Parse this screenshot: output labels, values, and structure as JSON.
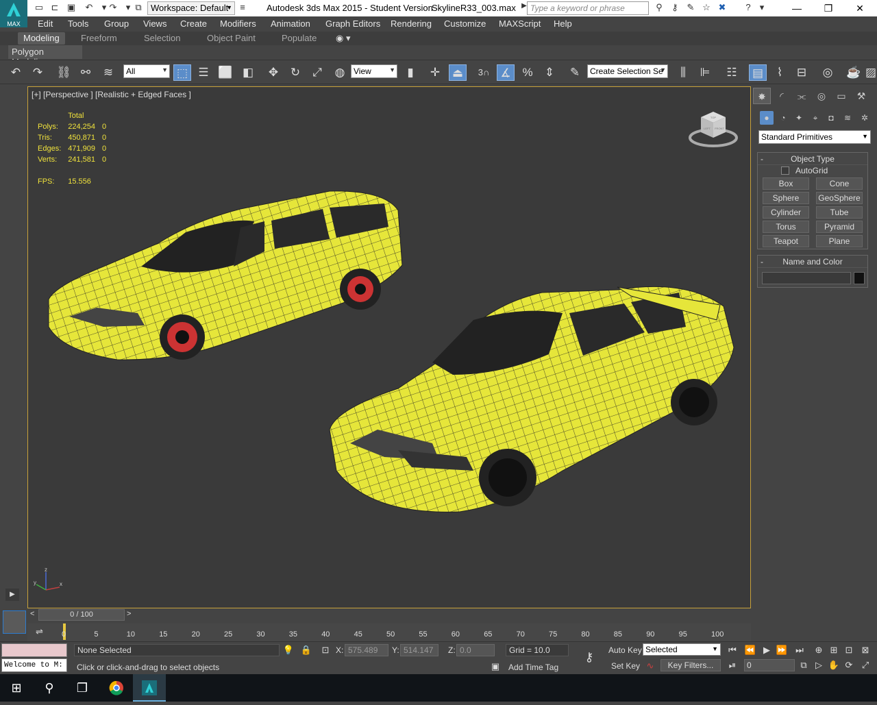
{
  "titlebar": {
    "workspace": "Workspace: Default",
    "app_title": "Autodesk 3ds Max  2015   - Student Version",
    "file_name": "SkylineR33_003.max",
    "search_placeholder": "Type a keyword or phrase",
    "logo_text": "MAX"
  },
  "menu": [
    "Edit",
    "Tools",
    "Group",
    "Views",
    "Create",
    "Modifiers",
    "Animation",
    "Graph Editors",
    "Rendering",
    "Customize",
    "MAXScript",
    "Help"
  ],
  "ribbon": {
    "tabs": [
      "Modeling",
      "Freeform",
      "Selection",
      "Object Paint",
      "Populate"
    ],
    "active_tab": "Modeling",
    "panel_label": "Polygon Modeling"
  },
  "toolbar": {
    "filter": "All",
    "refcoord": "View",
    "snap_label": "3",
    "selection_set": "Create Selection Se"
  },
  "viewport": {
    "label": "[+] [Perspective ] [Realistic + Edged Faces ]",
    "stats_header": "Total",
    "stats": [
      {
        "name": "Polys:",
        "total": "224,254",
        "sel": "0"
      },
      {
        "name": "Tris:",
        "total": "450,871",
        "sel": "0"
      },
      {
        "name": "Edges:",
        "total": "471,909",
        "sel": "0"
      },
      {
        "name": "Verts:",
        "total": "241,581",
        "sel": "0"
      }
    ],
    "fps_label": "FPS:",
    "fps_value": "15.556",
    "viewcube_top": "TOP",
    "viewcube_left": "LEFT",
    "viewcube_front": "FRONT",
    "axis_x": "x",
    "axis_y": "y",
    "axis_z": "z",
    "model_color": "#e6e63a"
  },
  "command_panel": {
    "category": "Standard Primitives",
    "object_type_title": "Object Type",
    "autogrid": "AutoGrid",
    "buttons": [
      "Box",
      "Cone",
      "Sphere",
      "GeoSphere",
      "Cylinder",
      "Tube",
      "Torus",
      "Pyramid",
      "Teapot",
      "Plane"
    ],
    "name_color_title": "Name and Color",
    "swatch_color": "#111111"
  },
  "timeline": {
    "slider_text": "0 / 100",
    "ticks": [
      "0",
      "5",
      "10",
      "15",
      "20",
      "25",
      "30",
      "35",
      "40",
      "45",
      "50",
      "55",
      "60",
      "65",
      "70",
      "75",
      "80",
      "85",
      "90",
      "95",
      "100"
    ]
  },
  "status": {
    "listener": "Welcome to M:",
    "selection": "None Selected",
    "prompt": "Click or click-and-drag to select objects",
    "x_label": "X:",
    "x": "575.489",
    "y_label": "Y:",
    "y": "514.147",
    "z_label": "Z:",
    "z": "0.0",
    "grid": "Grid = 10.0",
    "add_time_tag": "Add Time Tag",
    "auto_key": "Auto Key",
    "set_key": "Set Key",
    "key_mode": "Selected",
    "key_filters": "Key Filters...",
    "frame": "0"
  }
}
